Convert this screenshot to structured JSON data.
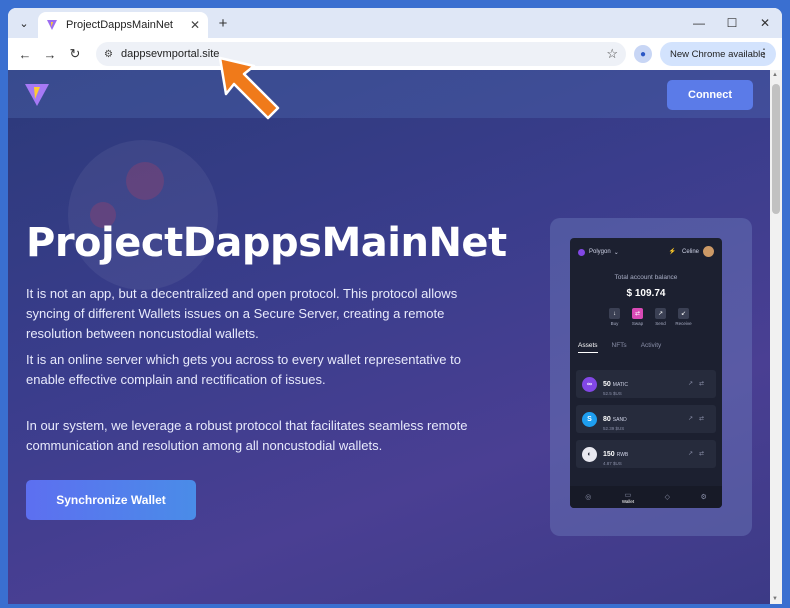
{
  "browser": {
    "tab_title": "ProjectDappsMainNet",
    "url": "dappsevmportal.site",
    "update_label": "New Chrome available"
  },
  "header": {
    "connect_label": "Connect"
  },
  "hero": {
    "title": "ProjectDappsMainNet",
    "paragraph1": "It is not an app, but a decentralized and open protocol. This protocol allows syncing of different Wallets issues on a Secure Server, creating a remote resolution between noncustodial wallets.",
    "paragraph2": "It is an online server which gets you across to every wallet representative to enable effective complain and rectification of issues.",
    "paragraph3": "In our system, we leverage a robust protocol that facilitates seamless remote communication and resolution among all noncustodial wallets.",
    "sync_label": "Synchronize Wallet"
  },
  "phone": {
    "network": "Polygon",
    "user": "Celine",
    "balance_label": "Total account balance",
    "balance_currency": "$",
    "balance_value": "109.74",
    "actions": [
      "Buy",
      "Swap",
      "Send",
      "Receive"
    ],
    "tabs": [
      "Assets",
      "NFTs",
      "Activity"
    ],
    "assets": [
      {
        "amount": "50",
        "symbol": "MATIC",
        "usd": "52.5 $US",
        "color": "#8247e5"
      },
      {
        "amount": "80",
        "symbol": "SAND",
        "usd": "52.39 $US",
        "color": "#1e9ef0"
      },
      {
        "amount": "150",
        "symbol": "RWB",
        "usd": "4.87 $US",
        "color": "#e8e8f0"
      }
    ],
    "nav_active": "Wallet"
  },
  "colors": {
    "accent": "#5b7be8",
    "chrome_frame": "#dfe7f6"
  }
}
